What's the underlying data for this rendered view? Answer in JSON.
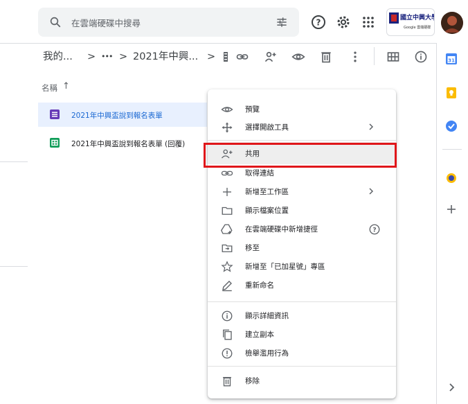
{
  "search": {
    "placeholder": "在雲端硬碟中搜尋"
  },
  "header": {
    "logo_text": "國立中興大學",
    "logo_sub": "Google 雲端硬碟"
  },
  "breadcrumb": {
    "root": "我的...",
    "sep1": ">",
    "ellipsis": "•••",
    "sep2": ">",
    "folder": "2021年中興...",
    "sep3": ">"
  },
  "list": {
    "sort_label": "名稱",
    "sort_arrow": "↑"
  },
  "files": [
    {
      "name": "2021年中興盃說到報名表單",
      "color": "#673ab7",
      "type": "form"
    },
    {
      "name": "2021年中興盃說到報名表單 (回覆)",
      "color": "#0f9d58",
      "type": "sheet"
    }
  ],
  "menu": {
    "items": [
      {
        "label": "預覽",
        "icon": "eye-icon"
      },
      {
        "label": "選擇開啟工具",
        "icon": "move-icon",
        "arrow": true
      },
      {
        "label": "共用",
        "icon": "person-add-icon"
      },
      {
        "label": "取得連結",
        "icon": "link-icon"
      },
      {
        "label": "新增至工作區",
        "icon": "plus-icon",
        "arrow": true
      },
      {
        "label": "顯示檔案位置",
        "icon": "folder-icon"
      },
      {
        "label": "在雲端硬碟中新增捷徑",
        "icon": "shortcut-icon",
        "help": true
      },
      {
        "label": "移至",
        "icon": "move-to-icon"
      },
      {
        "label": "新增至「已加星號」專區",
        "icon": "star-icon"
      },
      {
        "label": "重新命名",
        "icon": "pencil-icon"
      },
      {
        "label": "顯示詳細資訊",
        "icon": "info-icon"
      },
      {
        "label": "建立副本",
        "icon": "copy-icon"
      },
      {
        "label": "檢舉濫用行為",
        "icon": "report-icon"
      },
      {
        "label": "移除",
        "icon": "trash-icon"
      }
    ]
  },
  "colors": {
    "highlight": "#e0161a",
    "selected_row": "#e8f0fe"
  }
}
